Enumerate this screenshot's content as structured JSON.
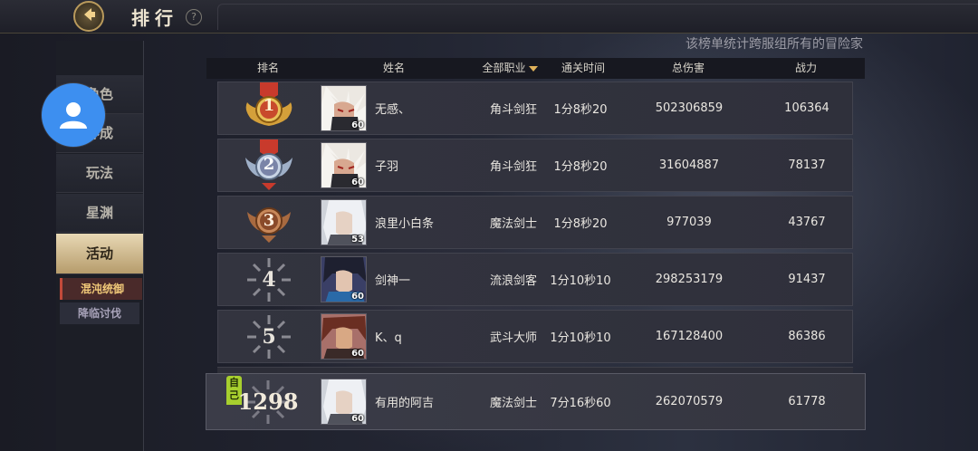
{
  "header": {
    "title": "排行",
    "help": "?",
    "back_icon": "back-arrow-icon"
  },
  "notice": "该榜单统计跨服组所有的冒险家",
  "sidebar": {
    "items": [
      "角色",
      "养成",
      "玩法",
      "星渊",
      "活动"
    ],
    "active": "活动",
    "sub_items": [
      "混沌统御",
      "降临讨伐"
    ],
    "active_sub": "混沌统御"
  },
  "table": {
    "columns": {
      "rank": "排名",
      "name": "姓名",
      "job": "全部职业",
      "time": "通关时间",
      "damage": "总伤害",
      "power": "战力"
    },
    "rows": [
      {
        "rank": "1",
        "medal": "gold",
        "level": "60",
        "name": "无感、",
        "job": "角斗剑狂",
        "time": "1分8秒20",
        "damage": "502306859",
        "power": "106364"
      },
      {
        "rank": "2",
        "medal": "silver",
        "level": "60",
        "name": "子羽",
        "job": "角斗剑狂",
        "time": "1分8秒20",
        "damage": "31604887",
        "power": "78137"
      },
      {
        "rank": "3",
        "medal": "bronze",
        "level": "53",
        "name": "浪里小白条",
        "job": "魔法剑士",
        "time": "1分8秒20",
        "damage": "977039",
        "power": "43767"
      },
      {
        "rank": "4",
        "medal": "plain",
        "level": "60",
        "name": "剑神一",
        "job": "流浪剑客",
        "time": "1分10秒10",
        "damage": "298253179",
        "power": "91437"
      },
      {
        "rank": "5",
        "medal": "plain",
        "level": "60",
        "name": "K、q",
        "job": "武斗大师",
        "time": "1分10秒10",
        "damage": "167128400",
        "power": "86386"
      }
    ],
    "self_row": {
      "tag": "自己",
      "rank": "1298",
      "level": "60",
      "name": "有用的阿吉",
      "job": "魔法剑士",
      "time": "7分16秒60",
      "damage": "262070579",
      "power": "61778"
    }
  },
  "colors": {
    "gold": "#d4a03a",
    "silver": "#9fb0c8",
    "bronze": "#a86a40",
    "ribbon": "#c83a2c",
    "accent": "#e0b25a",
    "self_tag": "#a7cf2e",
    "avatar": "#3d8ff0"
  }
}
